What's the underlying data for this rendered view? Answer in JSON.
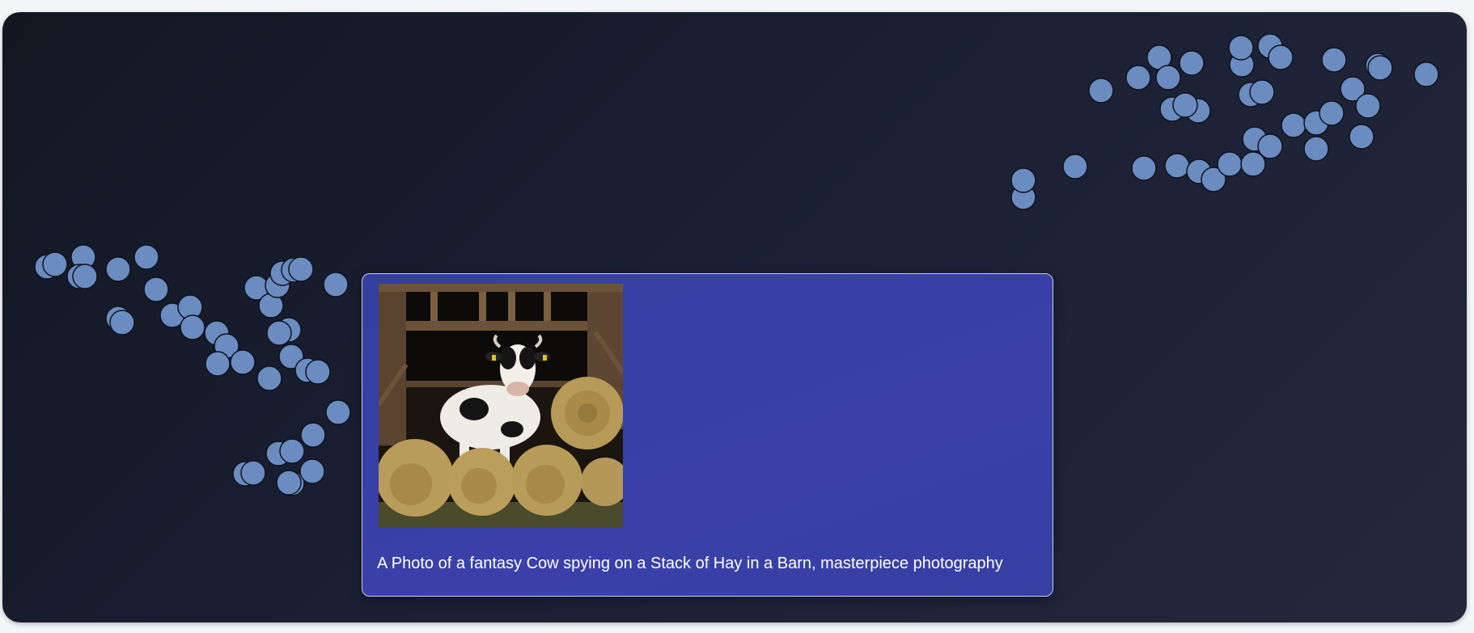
{
  "tooltip": {
    "caption": "A Photo of a fantasy Cow spying on a Stack of Hay in a Barn, masterpiece photography",
    "image_subject": "cow-in-barn-with-hay-bales"
  },
  "colors": {
    "background": "#161b2b",
    "point_fill": "#6a8cc0",
    "point_stroke": "#0f1320",
    "tooltip_fill": "#3840a6",
    "tooltip_border": "#c9cde8"
  }
}
